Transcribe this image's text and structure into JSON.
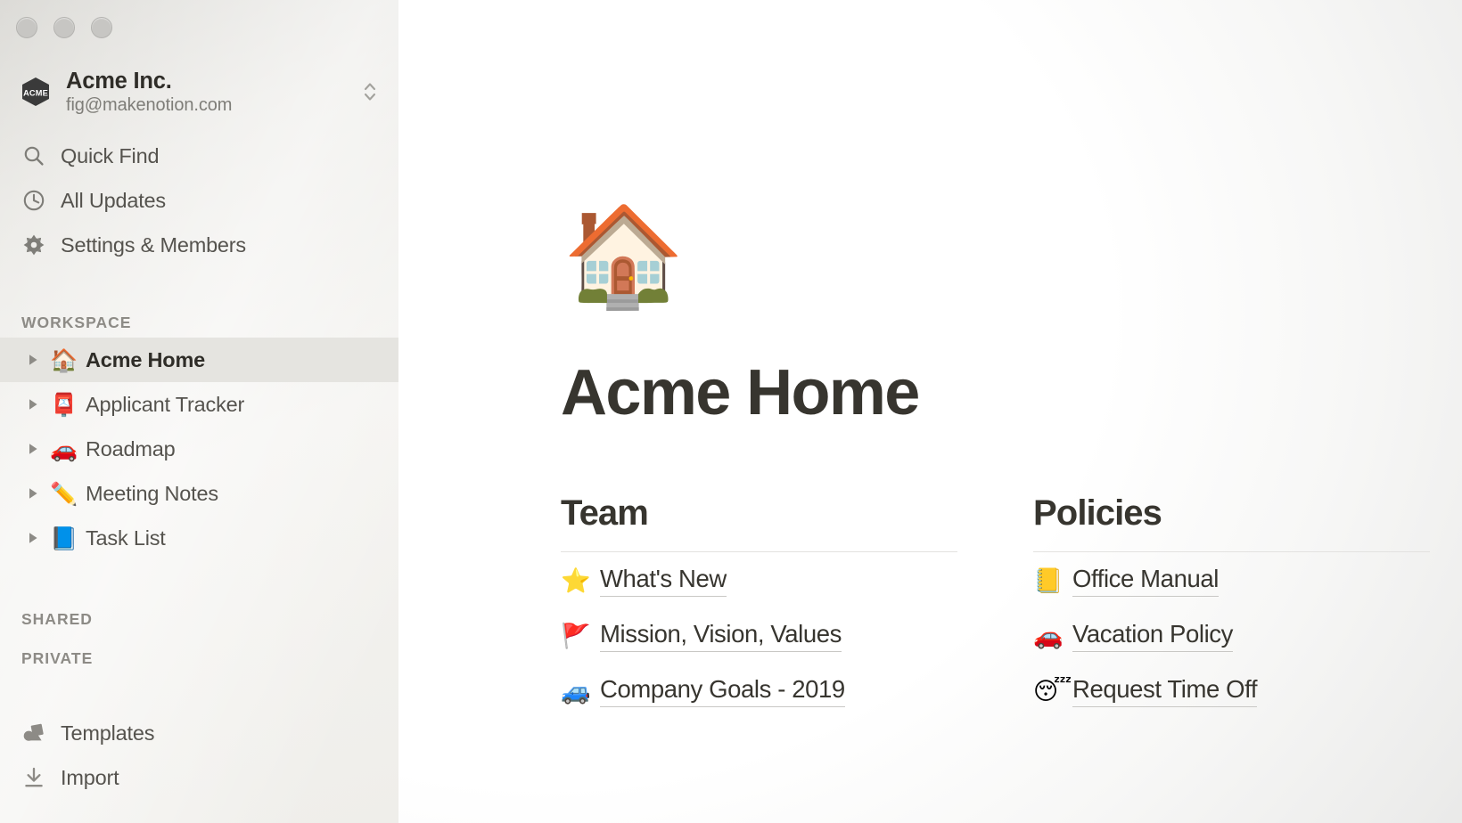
{
  "window": {
    "traffic_lights": [
      "close",
      "minimize",
      "zoom"
    ]
  },
  "sidebar": {
    "workspace": {
      "logo_text": "ACME",
      "name": "Acme Inc.",
      "email": "fig@makenotion.com",
      "switcher_icon": "chevron-up-down-icon"
    },
    "nav": [
      {
        "label": "Quick Find",
        "icon": "search-icon"
      },
      {
        "label": "All Updates",
        "icon": "clock-icon"
      },
      {
        "label": "Settings & Members",
        "icon": "gear-icon"
      }
    ],
    "sections": {
      "workspace_heading": "WORKSPACE",
      "shared_heading": "SHARED",
      "private_heading": "PRIVATE"
    },
    "pages": [
      {
        "label": "Acme Home",
        "emoji": "🏠",
        "emoji_name": "house-emoji",
        "selected": true
      },
      {
        "label": "Applicant Tracker",
        "emoji": "📮",
        "emoji_name": "postbox-emoji",
        "selected": false
      },
      {
        "label": "Roadmap",
        "emoji": "🚗",
        "emoji_name": "car-emoji",
        "selected": false
      },
      {
        "label": "Meeting Notes",
        "emoji": "✏️",
        "emoji_name": "pencil-emoji",
        "selected": false
      },
      {
        "label": "Task List",
        "emoji": "📘",
        "emoji_name": "blue-book-emoji",
        "selected": false
      }
    ],
    "bottom": [
      {
        "label": "Templates",
        "icon": "templates-icon"
      },
      {
        "label": "Import",
        "icon": "import-icon"
      }
    ]
  },
  "page": {
    "hero_emoji": "🏠",
    "hero_emoji_name": "house-emoji",
    "title": "Acme Home",
    "columns": [
      {
        "heading": "Team",
        "links": [
          {
            "label": "What's New",
            "emoji": "⭐",
            "emoji_name": "star-emoji"
          },
          {
            "label": "Mission, Vision, Values",
            "emoji": "🚩",
            "emoji_name": "triangular-flag-emoji"
          },
          {
            "label": "Company Goals - 2019",
            "emoji": "🚙",
            "emoji_name": "recreational-vehicle-emoji"
          }
        ]
      },
      {
        "heading": "Policies",
        "links": [
          {
            "label": "Office Manual",
            "emoji": "📒",
            "emoji_name": "ledger-emoji"
          },
          {
            "label": "Vacation Policy",
            "emoji": "🚗",
            "emoji_name": "car-emoji"
          },
          {
            "label": "Request Time Off",
            "emoji": "😴",
            "emoji_name": "sleeping-face-emoji"
          }
        ]
      }
    ]
  },
  "colors": {
    "sidebar_bg": "#f1f0ec",
    "sidebar_selected": "#e5e4e0",
    "text_primary": "#37352f",
    "text_secondary": "#55534e",
    "text_muted": "#8d8b86",
    "rule": "#e3e2e0"
  }
}
